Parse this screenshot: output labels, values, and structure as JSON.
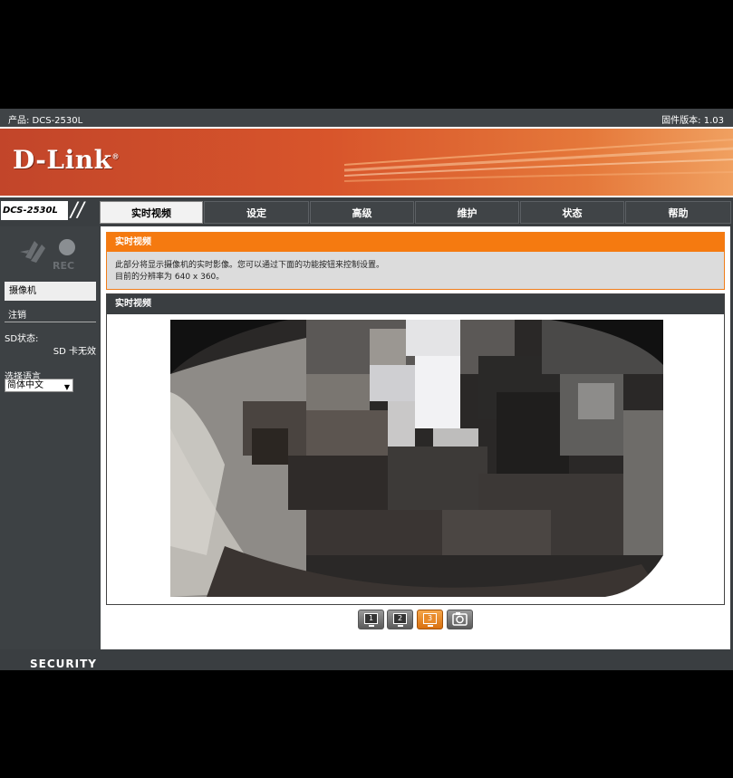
{
  "topbar": {
    "product": "产品: DCS-2530L",
    "firmware": "固件版本: 1.03"
  },
  "brand": {
    "logo": "D-Link",
    "logo_mark": "®",
    "model_tab": "DCS-2530L",
    "footer": "SECURITY"
  },
  "nav": {
    "items": [
      {
        "label": "实时视频",
        "active": true
      },
      {
        "label": "设定"
      },
      {
        "label": "高级"
      },
      {
        "label": "维护"
      },
      {
        "label": "状态"
      },
      {
        "label": "帮助"
      }
    ]
  },
  "sidebar": {
    "rec_label": "REC",
    "camera": "摄像机",
    "logout": "注销",
    "sd_label": "SD状态:",
    "sd_value": "SD 卡无效",
    "lang_label": "选择语言",
    "lang_value": "简体中文"
  },
  "info": {
    "title": "实时视频",
    "line1": "此部分将显示摄像机的实时影像。您可以通过下面的功能按钮来控制设置。",
    "line2": "目前的分辨率为 640 x 360。"
  },
  "video": {
    "title": "实时视频"
  },
  "controls": [
    {
      "label": "1",
      "active": false
    },
    {
      "label": "2",
      "active": false
    },
    {
      "label": "3",
      "active": true
    }
  ],
  "colors": {
    "accent": "#f57a10",
    "banner": "#d8552b",
    "chrome": "#3a3e41"
  }
}
